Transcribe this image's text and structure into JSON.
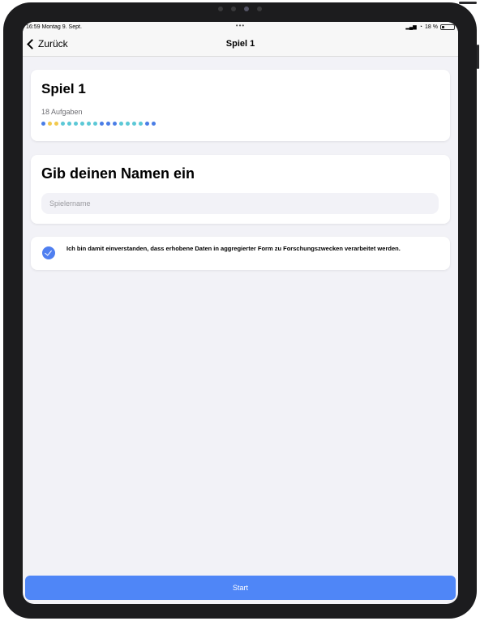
{
  "status_bar": {
    "time_date": "16:59  Montag 9. Sept.",
    "center_dots": "•••",
    "signal": "▂▄▆",
    "wifi": "◔",
    "battery_text": "18 %"
  },
  "nav": {
    "back_label": "Zurück",
    "title": "Spiel 1"
  },
  "game_card": {
    "title": "Spiel 1",
    "subtitle": "18 Aufgaben",
    "dot_colors": [
      "#4a7de6",
      "#f2c94c",
      "#f2c94c",
      "#5bc8d6",
      "#5bc8d6",
      "#5bc8d6",
      "#5bc8d6",
      "#5bc8d6",
      "#5bc8d6",
      "#4a7de6",
      "#4a7de6",
      "#4a7de6",
      "#5bc8d6",
      "#5bc8d6",
      "#5bc8d6",
      "#5bc8d6",
      "#4a7de6",
      "#4a7de6"
    ]
  },
  "name_card": {
    "title": "Gib deinen Namen ein",
    "placeholder": "Spielername",
    "value": ""
  },
  "consent": {
    "checked": true,
    "text": "Ich bin damit einverstanden, dass erhobene Daten in aggregierter Form zu Forschungszwecken verarbeitet werden."
  },
  "start_label": "Start",
  "colors": {
    "accent": "#4f86f7",
    "background": "#f2f2f7",
    "card": "#ffffff"
  }
}
